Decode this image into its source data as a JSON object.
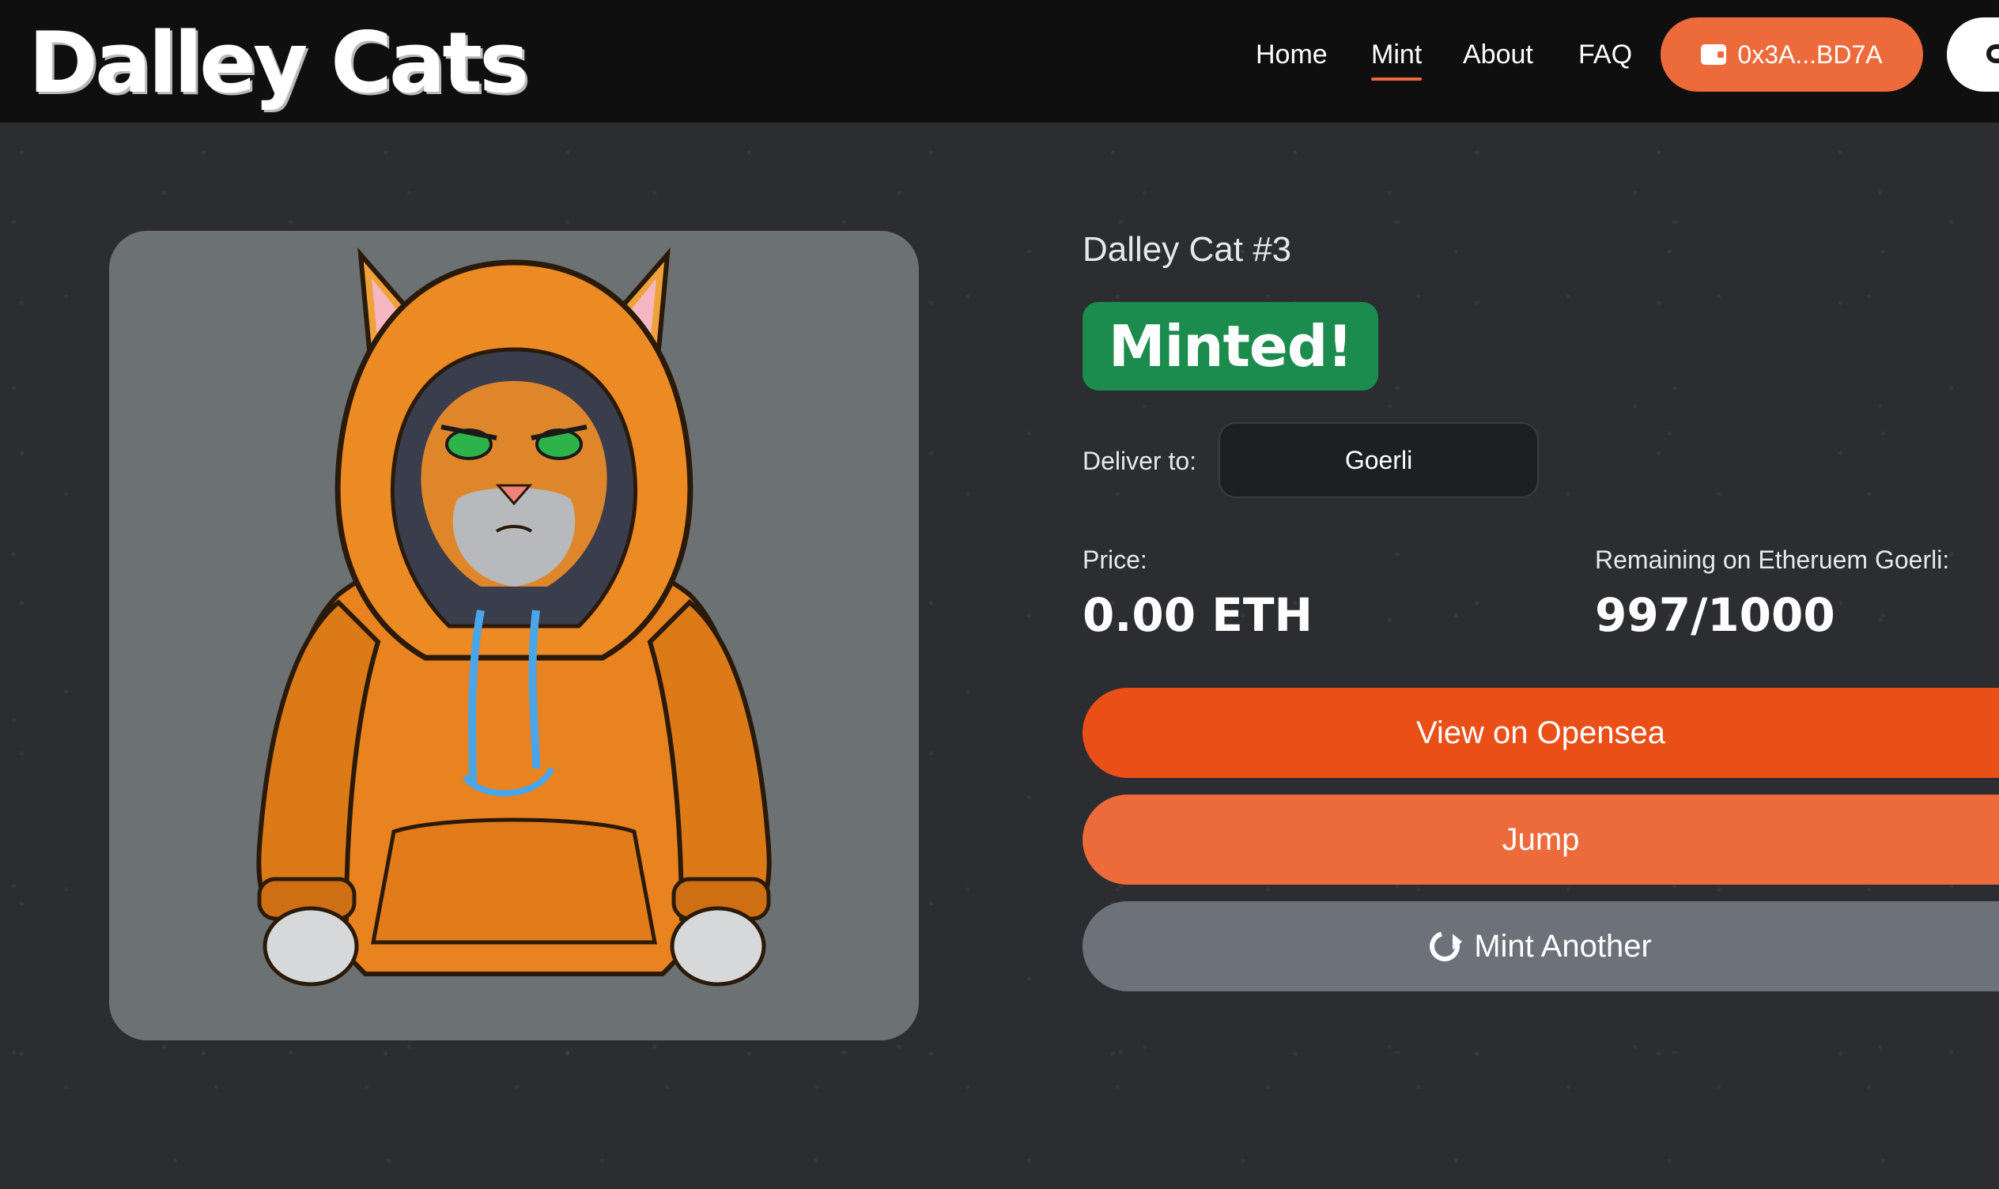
{
  "header": {
    "logo": "Dalley Cats",
    "nav": {
      "home": "Home",
      "mint": "Mint",
      "about": "About",
      "faq": "FAQ"
    },
    "wallet_address": "0x3A...BD7A",
    "wallet_icon": "wallet-icon",
    "extra_icon": "chat-icon"
  },
  "nft": {
    "image_subject": "cartoon cat in orange hoodie",
    "title": "Dalley Cat #3",
    "status": "Minted!",
    "deliver_label": "Deliver to:",
    "network": "Goerli",
    "price_label": "Price:",
    "price_value": "0.00 ETH",
    "remaining_label": "Remaining on Etheruem Goerli:",
    "remaining_value": "997/1000"
  },
  "actions": {
    "opensea": "View on Opensea",
    "jump": "Jump",
    "mint_another": "Mint Another",
    "mint_another_icon": "refresh-icon"
  },
  "colors": {
    "accent": "#eb4f18",
    "accent_light": "#ed6a3b",
    "success": "#1b8c4d",
    "background": "#2b2d30",
    "header": "#0f0f0f",
    "secondary_button": "#6c717a"
  }
}
